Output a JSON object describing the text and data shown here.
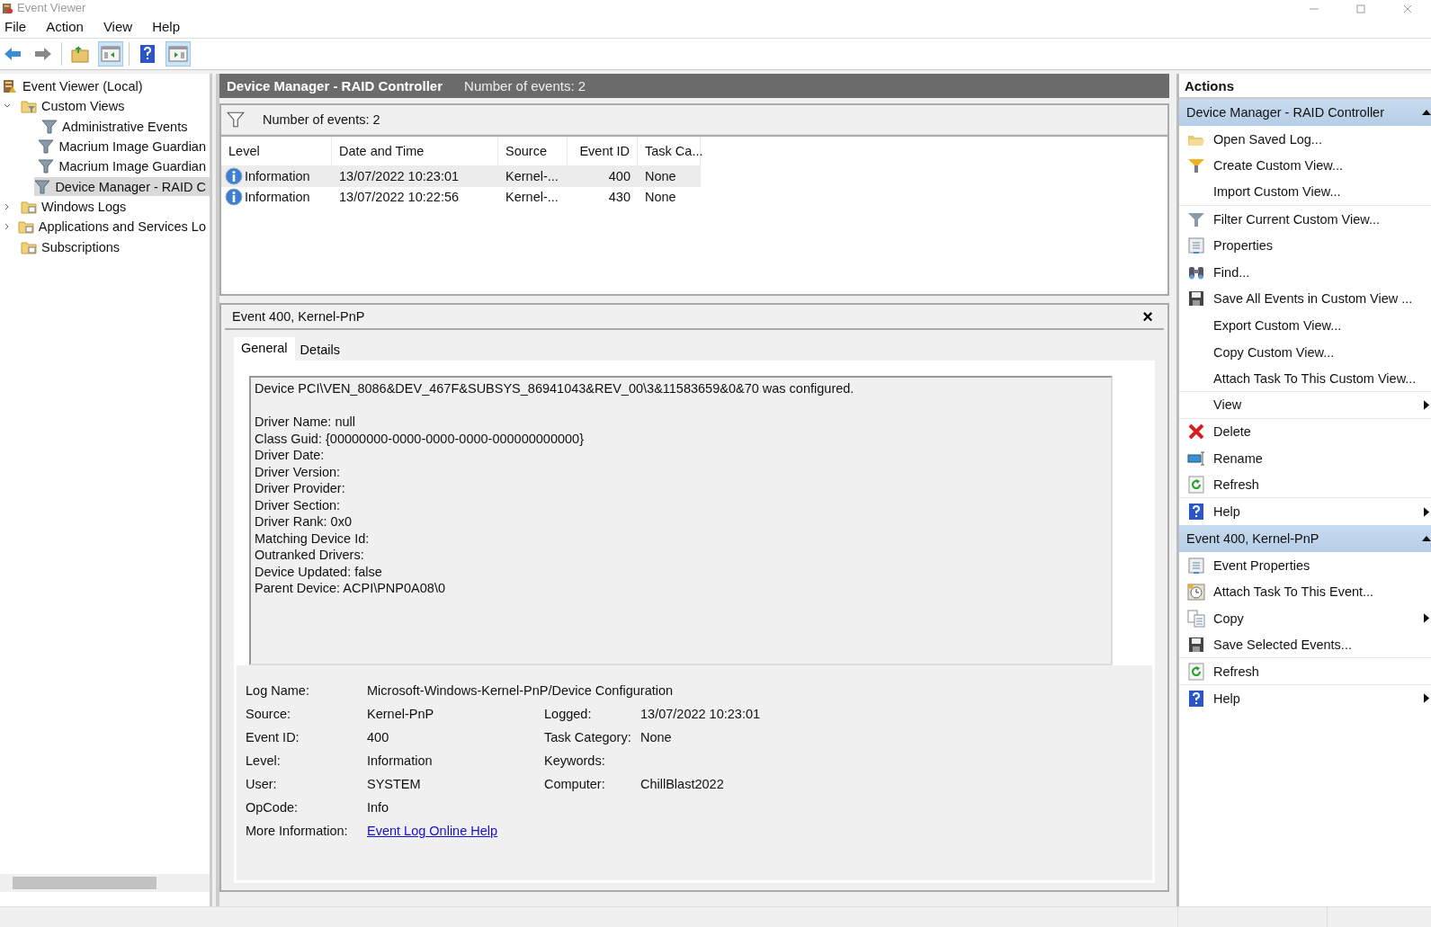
{
  "window": {
    "title": "Event Viewer"
  },
  "menu": [
    "File",
    "Action",
    "View",
    "Help"
  ],
  "toolbar": [
    {
      "kind": "back",
      "pressed": false
    },
    {
      "kind": "forward",
      "pressed": false
    },
    {
      "kind": "up",
      "pressed": false
    },
    {
      "kind": "tree",
      "pressed": true
    },
    {
      "kind": "help",
      "pressed": false
    },
    {
      "kind": "actions",
      "pressed": true
    }
  ],
  "tree": [
    {
      "label": "Event Viewer (Local)",
      "kind": "root",
      "selected": false,
      "children": [
        {
          "label": "Custom Views",
          "kind": "filter-folder",
          "expanded": true,
          "selected": false,
          "children": [
            {
              "label": "Administrative Events",
              "kind": "view",
              "selected": false
            },
            {
              "label": "Macrium Image Guardian",
              "kind": "view",
              "selected": false
            },
            {
              "label": "Macrium Image Guardian",
              "kind": "view",
              "selected": false
            },
            {
              "label": "Device Manager - RAID C",
              "kind": "view",
              "selected": true
            }
          ]
        },
        {
          "label": "Windows Logs",
          "kind": "folder",
          "expanded": false,
          "selected": false
        },
        {
          "label": "Applications and Services Lo",
          "kind": "folder",
          "expanded": false,
          "selected": false
        },
        {
          "label": "Subscriptions",
          "kind": "folder",
          "selected": false
        }
      ]
    }
  ],
  "view": {
    "title": "Device Manager - RAID Controller",
    "count": "Number of events: 2",
    "filter_count": "Number of events: 2"
  },
  "table": {
    "columns": [
      "Level",
      "Date and Time",
      "Source",
      "Event ID",
      "Task Ca..."
    ],
    "rows": [
      {
        "cells": [
          "Information",
          "13/07/2022 10:23:01",
          "Kernel-...",
          "400",
          "None"
        ],
        "selected": true
      },
      {
        "cells": [
          "Information",
          "13/07/2022 10:22:56",
          "Kernel-...",
          "430",
          "None"
        ],
        "selected": false
      }
    ]
  },
  "detail": {
    "title": "Event 400, Kernel-PnP",
    "close": "×",
    "tabs": [
      {
        "label": "General",
        "selected": true
      },
      {
        "label": "Details",
        "selected": false
      }
    ],
    "message": [
      [
        "Device PCI\\VEN_8086&DEV_467F&SUBSYS_86941043&REV_00\\3&11583659&0&70 was configured."
      ],
      [
        "Driver Name: null",
        "Class Guid: {00000000-0000-0000-0000-000000000000}",
        "Driver Date:",
        "Driver Version:",
        "Driver Provider:",
        "Driver Section:",
        "Driver Rank: 0x0",
        "Matching Device Id:",
        "Outranked Drivers:",
        "Device Updated: false",
        "Parent Device: ACPI\\PNP0A08\\0"
      ]
    ],
    "properties": [
      {
        "label": "Log Name:",
        "value": "Microsoft-Windows-Kernel-PnP/Device Configuration"
      },
      {
        "label": "Source:",
        "value": "Kernel-PnP",
        "label_2": "Logged:",
        "value_2": "13/07/2022 10:23:01"
      },
      {
        "label": "Event ID:",
        "value": "400",
        "label_2": "Task Category:",
        "value_2": "None"
      },
      {
        "label": "Level:",
        "value": "Information",
        "label_2": "Keywords:"
      },
      {
        "label": "User:",
        "value": "SYSTEM",
        "label_2": "Computer:",
        "value_2": "ChillBlast2022"
      },
      {
        "label": "OpCode:",
        "value": "Info"
      },
      {
        "label": "More Information:",
        "link": "Event Log Online Help"
      }
    ]
  },
  "actions": {
    "title": "Actions",
    "sections": [
      {
        "title": "Device Manager - RAID Controller",
        "expanded": true,
        "items": [
          {
            "label": "Open Saved Log...",
            "kind": "open",
            "submenu": false,
            "divider": false
          },
          {
            "label": "Create Custom View...",
            "kind": "new-filter",
            "submenu": false,
            "divider": false
          },
          {
            "label": "Import Custom View...",
            "kind": "none",
            "submenu": false,
            "divider": true
          },
          {
            "label": "Filter Current Custom View...",
            "kind": "filter",
            "submenu": false,
            "divider": false
          },
          {
            "label": "Properties",
            "kind": "properties",
            "submenu": false,
            "divider": false
          },
          {
            "label": "Find...",
            "kind": "find",
            "submenu": false,
            "divider": false
          },
          {
            "label": "Save All Events in Custom View ...",
            "kind": "save",
            "submenu": false,
            "divider": false
          },
          {
            "label": "Export Custom View...",
            "kind": "none",
            "submenu": false,
            "divider": false
          },
          {
            "label": "Copy Custom View...",
            "kind": "none",
            "submenu": false,
            "divider": false
          },
          {
            "label": "Attach Task To This Custom View...",
            "kind": "none",
            "submenu": false,
            "divider": true
          },
          {
            "label": "View",
            "kind": "none",
            "submenu": true,
            "divider": true
          },
          {
            "label": "Delete",
            "kind": "delete",
            "submenu": false,
            "divider": false
          },
          {
            "label": "Rename",
            "kind": "rename",
            "submenu": false,
            "divider": false
          },
          {
            "label": "Refresh",
            "kind": "refresh",
            "submenu": false,
            "divider": true
          },
          {
            "label": "Help",
            "kind": "help",
            "submenu": true,
            "divider": false
          }
        ]
      },
      {
        "title": "Event 400, Kernel-PnP",
        "expanded": true,
        "items": [
          {
            "label": "Event Properties",
            "kind": "properties",
            "submenu": false,
            "divider": false
          },
          {
            "label": "Attach Task To This Event...",
            "kind": "task",
            "submenu": false,
            "divider": false
          },
          {
            "label": "Copy",
            "kind": "copy",
            "submenu": true,
            "divider": false
          },
          {
            "label": "Save Selected Events...",
            "kind": "save",
            "submenu": false,
            "divider": true
          },
          {
            "label": "Refresh",
            "kind": "refresh",
            "submenu": false,
            "divider": true
          },
          {
            "label": "Help",
            "kind": "help",
            "submenu": true,
            "divider": false
          }
        ]
      }
    ]
  }
}
